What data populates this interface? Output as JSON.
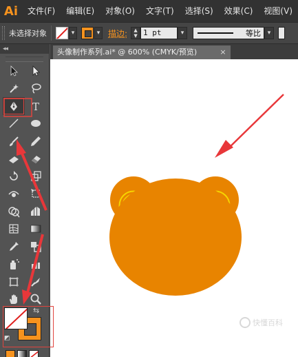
{
  "app": {
    "logo": "Ai",
    "brand_color": "#f7931e"
  },
  "menu": [
    "文件(F)",
    "编辑(E)",
    "对象(O)",
    "文字(T)",
    "选择(S)",
    "效果(C)",
    "视图(V)"
  ],
  "control": {
    "selection": "未选择对象",
    "stroke_label": "描边:",
    "stroke_weight": "1 pt",
    "profile": "等比"
  },
  "toolbox": {
    "collapse": "◂◂",
    "tools": [
      [
        "selection-tool",
        "direct-selection-tool"
      ],
      [
        "magic-wand-tool",
        "lasso-tool"
      ],
      [
        "pen-tool",
        "type-tool"
      ],
      [
        "line-segment-tool",
        "ellipse-tool"
      ],
      [
        "paintbrush-tool",
        "pencil-tool"
      ],
      [
        "blob-brush-tool",
        "eraser-tool"
      ],
      [
        "rotate-tool",
        "scale-tool"
      ],
      [
        "width-tool",
        "free-transform-tool"
      ],
      [
        "shape-builder-tool",
        "perspective-grid-tool"
      ],
      [
        "mesh-tool",
        "gradient-tool"
      ],
      [
        "eyedropper-tool",
        "blend-tool"
      ],
      [
        "symbol-sprayer-tool",
        "column-graph-tool"
      ],
      [
        "artboard-tool",
        "slice-tool"
      ],
      [
        "hand-tool",
        "zoom-tool"
      ]
    ],
    "active_tool": "pen-tool"
  },
  "fill_stroke": {
    "fill": "none",
    "stroke_color": "#f7931e"
  },
  "document": {
    "tab_title": "头像制作系列.ai* @ 600% (CMYK/预览)",
    "close": "×"
  },
  "artwork": {
    "bear_color": "#e88400",
    "ear_arc_color": "#f6d400",
    "arrow_color": "#e8373a"
  },
  "watermark": "快懂百科"
}
